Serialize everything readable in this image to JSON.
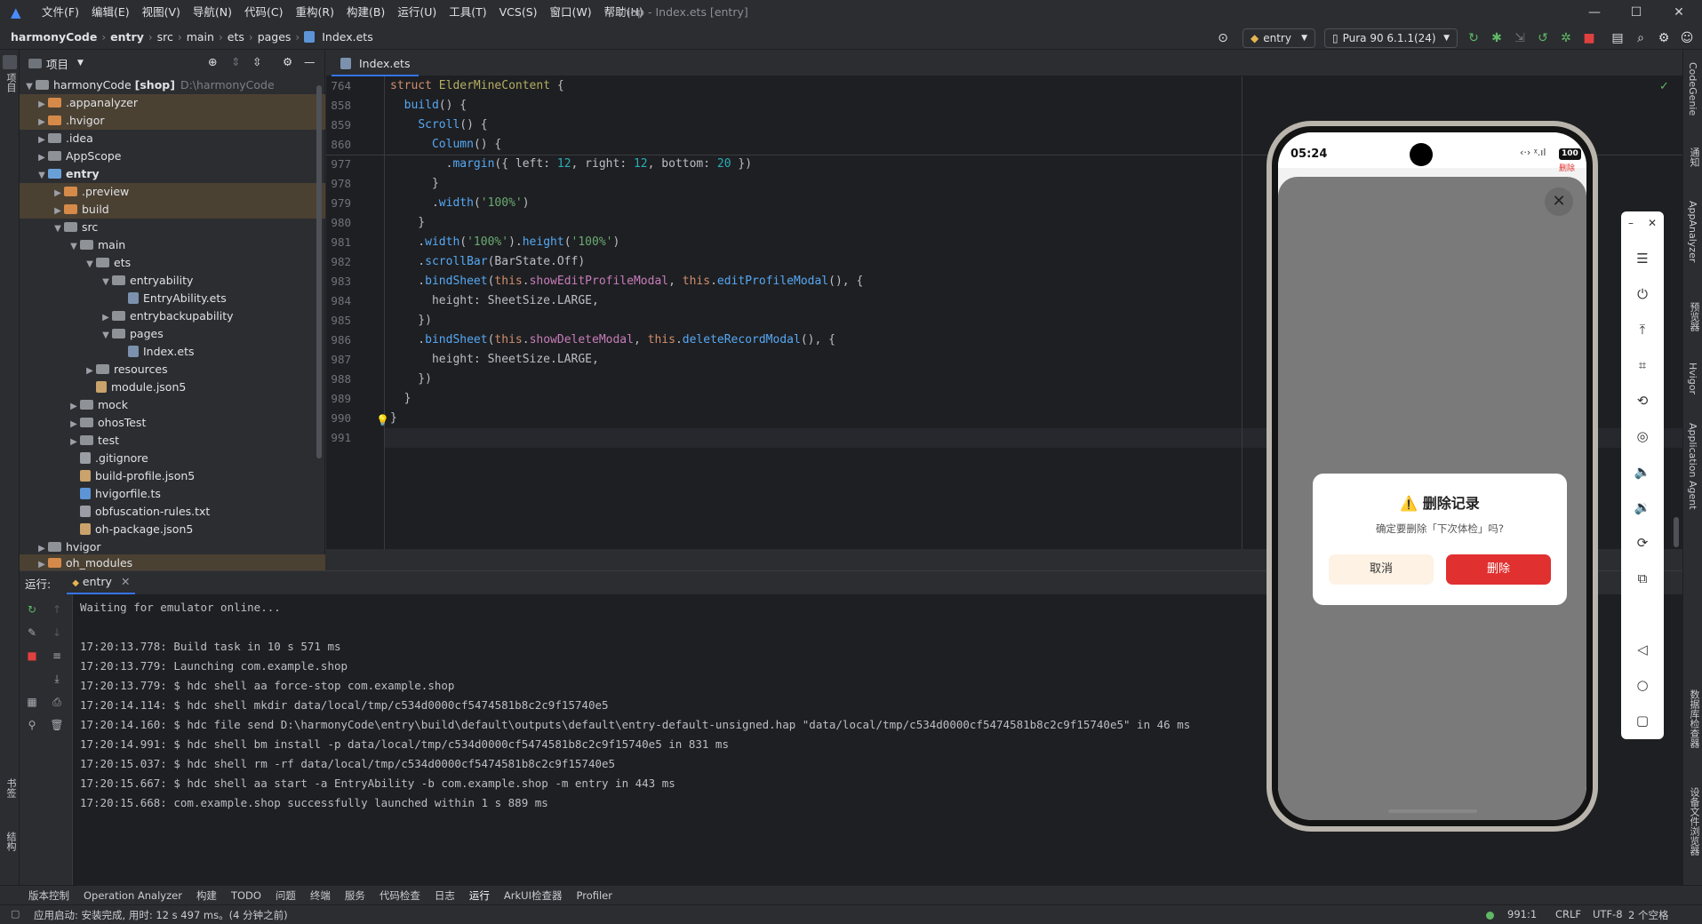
{
  "menu": [
    "文件(F)",
    "编辑(E)",
    "视图(V)",
    "导航(N)",
    "代码(C)",
    "重构(R)",
    "构建(B)",
    "运行(U)",
    "工具(T)",
    "VCS(S)",
    "窗口(W)",
    "帮助(H)"
  ],
  "window_title": "shop - Index.ets [entry]",
  "breadcrumbs": [
    "harmonyCode",
    "entry",
    "src",
    "main",
    "ets",
    "pages",
    "Index.ets"
  ],
  "toolbar": {
    "run_config": "entry",
    "device": "Pura 90 6.1.1(24)"
  },
  "project": {
    "header": "项目",
    "root_name": "harmonyCode",
    "root_module": "[shop]",
    "root_path": "D:\\harmonyCode",
    "items": [
      {
        "label": ".appanalyzer"
      },
      {
        "label": ".hvigor"
      },
      {
        "label": ".idea"
      },
      {
        "label": "AppScope"
      },
      {
        "label": "entry"
      },
      {
        "label": ".preview"
      },
      {
        "label": "build"
      },
      {
        "label": "src"
      },
      {
        "label": "main"
      },
      {
        "label": "ets"
      },
      {
        "label": "entryability"
      },
      {
        "label": "EntryAbility.ets"
      },
      {
        "label": "entrybackupability"
      },
      {
        "label": "pages"
      },
      {
        "label": "Index.ets"
      },
      {
        "label": "resources"
      },
      {
        "label": "module.json5"
      },
      {
        "label": "mock"
      },
      {
        "label": "ohosTest"
      },
      {
        "label": "test"
      },
      {
        "label": ".gitignore"
      },
      {
        "label": "build-profile.json5"
      },
      {
        "label": "hvigorfile.ts"
      },
      {
        "label": "obfuscation-rules.txt"
      },
      {
        "label": "oh-package.json5"
      },
      {
        "label": "hvigor"
      },
      {
        "label": "oh_modules"
      }
    ]
  },
  "editor": {
    "tab": "Index.ets",
    "line_numbers": [
      "764",
      "858",
      "859",
      "860",
      "977",
      "978",
      "979",
      "980",
      "981",
      "982",
      "983",
      "984",
      "985",
      "986",
      "987",
      "988",
      "989",
      "990",
      "991"
    ],
    "code": {
      "l764a": "struct ",
      "l764b": "ElderMineContent",
      "l764c": " {",
      "l858a": "  ",
      "l858b": "build",
      "l858c": "() {",
      "l859a": "    ",
      "l859b": "Scroll",
      "l859c": "() {",
      "l860a": "      ",
      "l860b": "Column",
      "l860c": "() {",
      "l977a": "        .",
      "l977b": "margin",
      "l977c": "({ left: ",
      "l977d": "12",
      "l977e": ", right: ",
      "l977f": "12",
      "l977g": ", bottom: ",
      "l977h": "20",
      "l977i": " })",
      "l978": "      }",
      "l979a": "      .",
      "l979b": "width",
      "l979c": "(",
      "l979d": "'100%'",
      "l979e": ")",
      "l980": "    }",
      "l981a": "    .",
      "l981b": "width",
      "l981c": "(",
      "l981d": "'100%'",
      "l981e": ").",
      "l981f": "height",
      "l981g": "(",
      "l981h": "'100%'",
      "l981i": ")",
      "l982a": "    .",
      "l982b": "scrollBar",
      "l982c": "(BarState.Off)",
      "l983a": "    .",
      "l983b": "bindSheet",
      "l983c": "(",
      "l983d": "this",
      ".l983e": "",
      "l983e": ".",
      "l983f": "showEditProfileModal",
      "l983g": ", ",
      "l983h": "this",
      "l983i": ".",
      "l983j": "editProfileModal",
      "l983k": "(), {",
      "l984": "      height: SheetSize.LARGE,",
      "l985": "    })",
      "l986a": "    .",
      "l986b": "bindSheet",
      "l986c": "(",
      "l986d": "this",
      "l986e": ".",
      "l986f": "showDeleteModal",
      "l986g": ", ",
      "l986h": "this",
      "l986i": ".",
      "l986j": "deleteRecordModal",
      "l986k": "(), {",
      "l987": "      height: SheetSize.LARGE,",
      "l988": "    })",
      "l989": "  }",
      "l990": "}"
    }
  },
  "run": {
    "label": "运行:",
    "tab": "entry",
    "log": [
      "Waiting for emulator online...",
      "",
      "17:20:13.778: Build task in 10 s 571 ms",
      "17:20:13.779: Launching com.example.shop",
      "17:20:13.779: $ hdc shell aa force-stop com.example.shop",
      "17:20:14.114: $ hdc shell mkdir data/local/tmp/c534d0000cf5474581b8c2c9f15740e5",
      "17:20:14.160: $ hdc file send D:\\harmonyCode\\entry\\build\\default\\outputs\\default\\entry-default-unsigned.hap \"data/local/tmp/c534d0000cf5474581b8c2c9f15740e5\" in 46 ms",
      "17:20:14.991: $ hdc shell bm install -p data/local/tmp/c534d0000cf5474581b8c2c9f15740e5 in 831 ms",
      "17:20:15.037: $ hdc shell rm -rf data/local/tmp/c534d0000cf5474581b8c2c9f15740e5",
      "17:20:15.667: $ hdc shell aa start -a EntryAbility -b com.example.shop -m entry in 443 ms",
      "17:20:15.668: com.example.shop successfully launched within 1 s 889 ms"
    ]
  },
  "bottom_tools": [
    "版本控制",
    "Operation Analyzer",
    "构建",
    "TODO",
    "问题",
    "终端",
    "服务",
    "代码检查",
    "日志",
    "运行",
    "ArkUI检查器",
    "Profiler"
  ],
  "status": {
    "message": "应用启动: 安装完成, 用时: 12 s 497 ms。(4 分钟之前)",
    "position": "991:1",
    "line_ending": "CRLF",
    "encoding": "UTF-8",
    "indent": "2 个空格"
  },
  "phone": {
    "time": "05:24",
    "battery": "100",
    "bg_text": "删除",
    "dialog": {
      "icon": "⚠️",
      "title": "删除记录",
      "message": "确定要删除「下次体检」吗?",
      "cancel": "取消",
      "confirm": "删除"
    }
  },
  "left_labels": [
    "项目",
    "书签",
    "结构"
  ],
  "right_labels": [
    "CodeGenie",
    "通知",
    "AppAnalyzer",
    "预览器",
    "Hvigor",
    "Application Agent",
    "数据库检查器",
    "设备文件浏览器"
  ],
  "colors": {
    "accent": "#3574f0",
    "danger": "#e03030",
    "cancel_bg": "#fdf2e4"
  }
}
